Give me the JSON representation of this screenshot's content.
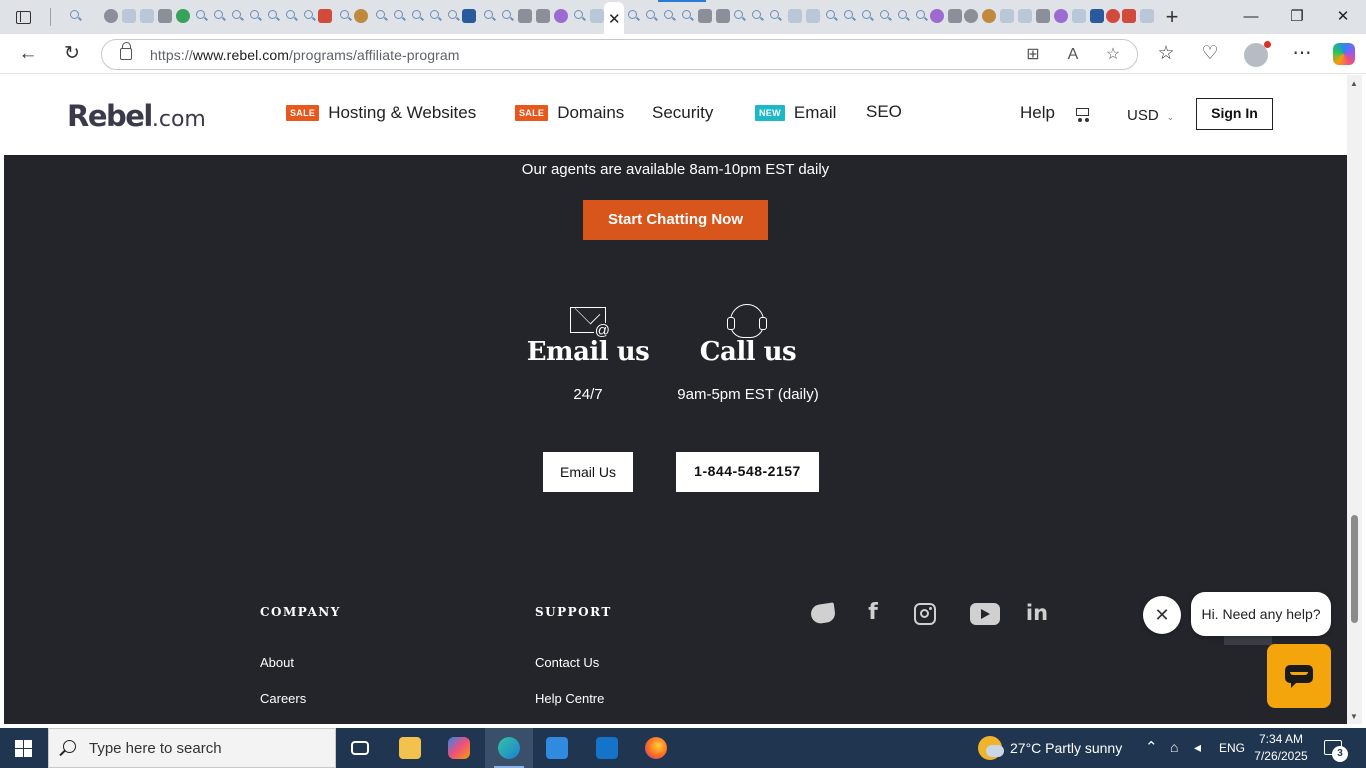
{
  "browser": {
    "url_prefix": "https://",
    "url_domain": "www.rebel.com",
    "url_path": "/programs/affiliate-program"
  },
  "site": {
    "logo": "Rebel",
    "logo_suffix": ".com",
    "nav": [
      {
        "badge": "SALE",
        "label": "Hosting & Websites"
      },
      {
        "badge": "SALE",
        "label": "Domains"
      },
      {
        "badge": "",
        "label": "Security"
      },
      {
        "badge": "NEW",
        "label": "Email"
      },
      {
        "badge": "",
        "label": "SEO"
      }
    ],
    "help": "Help",
    "currency": "USD",
    "sign_in": "Sign In"
  },
  "contact": {
    "agents_text": "Our agents are available 8am-10pm EST daily",
    "chat_button": "Start Chatting Now",
    "email_title": "Email us",
    "email_hours": "24/7",
    "email_button": "Email Us",
    "call_title": "Call us",
    "call_hours": "9am-5pm EST (daily)",
    "phone_button": "1-844-548-2157"
  },
  "footer": {
    "company_head": "COMPANY",
    "company_links": [
      "About",
      "Careers"
    ],
    "support_head": "SUPPORT",
    "support_links": [
      "Contact Us",
      "Help Centre"
    ],
    "social_in": "in"
  },
  "chat_widget": {
    "close": "✕",
    "greeting": "Hi. Need any help?"
  },
  "taskbar": {
    "search_placeholder": "Type here to search",
    "weather": "27°C  Partly sunny",
    "lang": "ENG",
    "time": "7:34 AM",
    "date": "7/26/2025",
    "notifications": "3"
  },
  "colors": {
    "footer_bg": "#23252b",
    "accent_orange": "#d8561c",
    "sale_badge": "#e8571c",
    "new_badge": "#1cb8c8",
    "chat_launcher": "#f5a50c"
  }
}
